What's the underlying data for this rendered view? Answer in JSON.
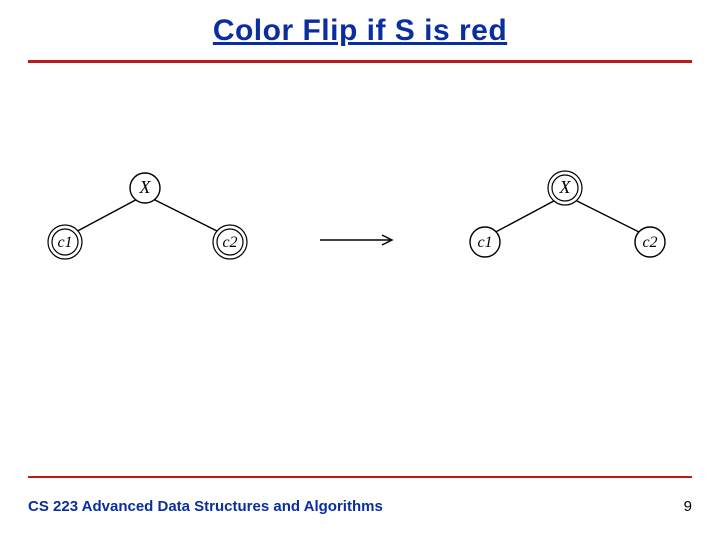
{
  "title": "Color Flip if S is red",
  "footer": "CS 223 Advanced Data Structures and Algorithms",
  "page_number": "9",
  "diagram": {
    "left_tree": {
      "root": "X",
      "left": "c1",
      "right": "c2"
    },
    "right_tree": {
      "root": "X",
      "left": "c1",
      "right": "c2"
    }
  }
}
